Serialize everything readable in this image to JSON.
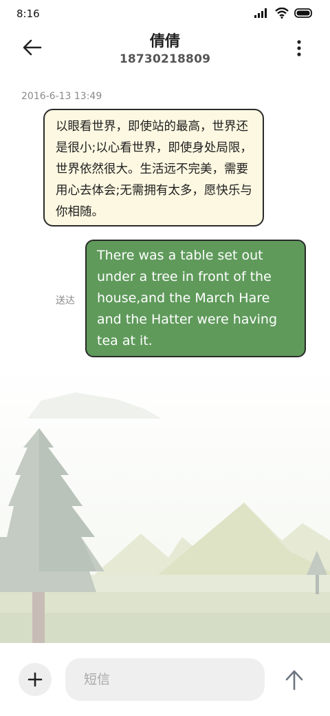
{
  "status_bar": {
    "time": "8:16",
    "icons": [
      "signal-icon",
      "wifi-icon",
      "battery-icon"
    ]
  },
  "header": {
    "contact_name": "倩倩",
    "phone_number": "18730218809"
  },
  "conversation": {
    "timestamp": "2016-6-13 13:49",
    "received_message": "以眼看世界，即使站的最高，世界还是很小;以心看世界，即使身处局限，世界依然很大。生活远不完美，需要用心去体会;无需拥有太多，愿快乐与你相随。",
    "sent_message": "There was a table set out under a tree in front of the house,and the March Hare and the Hatter were having tea at it.",
    "sent_status": "送达"
  },
  "composer": {
    "placeholder": "短信"
  },
  "colors": {
    "received_bubble": "#fdf8e2",
    "sent_bubble": "#5f9a5b",
    "bubble_border": "#2a2a2a"
  }
}
